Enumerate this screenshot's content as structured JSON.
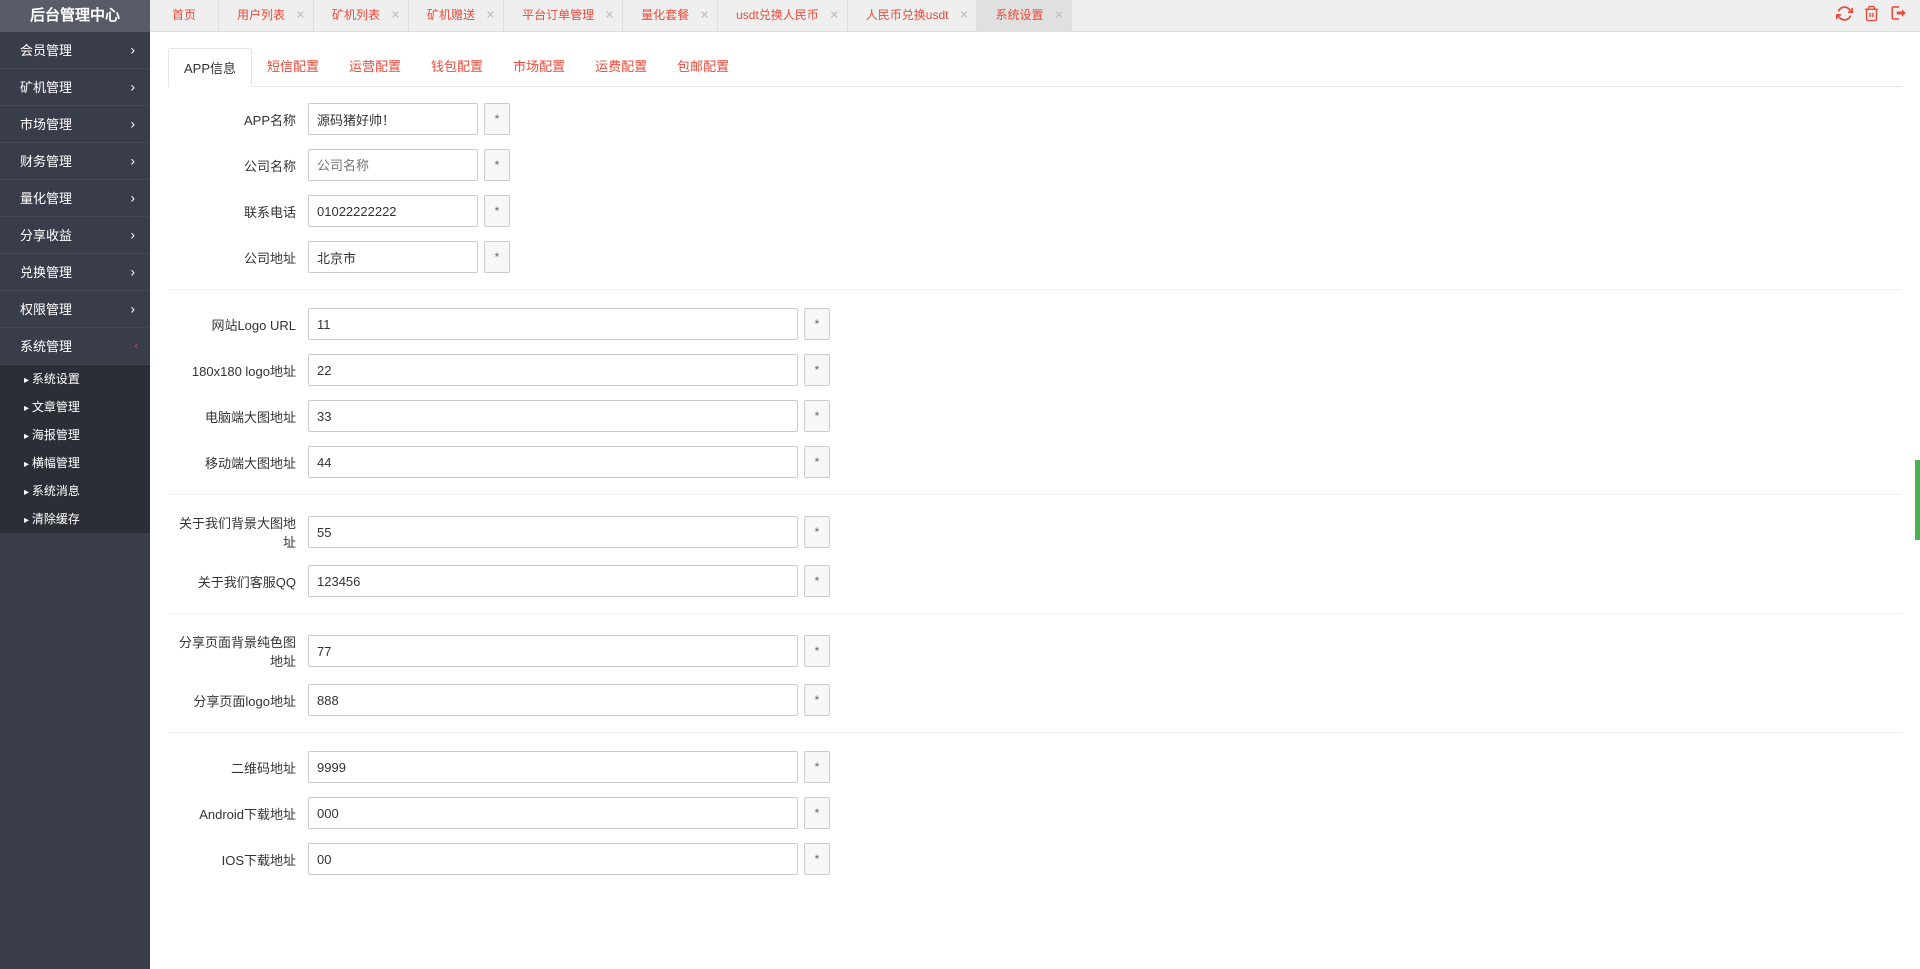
{
  "app_title": "后台管理中心",
  "sidebar": {
    "items": [
      {
        "label": "会员管理",
        "expandable": true
      },
      {
        "label": "矿机管理",
        "expandable": true
      },
      {
        "label": "市场管理",
        "expandable": true
      },
      {
        "label": "财务管理",
        "expandable": true
      },
      {
        "label": "量化管理",
        "expandable": true
      },
      {
        "label": "分享收益",
        "expandable": true
      },
      {
        "label": "兑换管理",
        "expandable": true
      },
      {
        "label": "权限管理",
        "expandable": true
      },
      {
        "label": "系统管理",
        "expandable": false,
        "expanded": true
      }
    ],
    "submenu": [
      {
        "label": "系统设置"
      },
      {
        "label": "文章管理"
      },
      {
        "label": "海报管理"
      },
      {
        "label": "横幅管理"
      },
      {
        "label": "系统消息"
      },
      {
        "label": "清除缓存"
      }
    ]
  },
  "tabs": [
    {
      "label": "首页",
      "closable": false
    },
    {
      "label": "用户列表",
      "closable": true
    },
    {
      "label": "矿机列表",
      "closable": true
    },
    {
      "label": "矿机赠送",
      "closable": true
    },
    {
      "label": "平台订单管理",
      "closable": true
    },
    {
      "label": "量化套餐",
      "closable": true
    },
    {
      "label": "usdt兑换人民币",
      "closable": true
    },
    {
      "label": "人民币兑换usdt",
      "closable": true
    },
    {
      "label": "系统设置",
      "closable": true,
      "active": true
    }
  ],
  "top_icons": {
    "refresh": "refresh-icon",
    "trash": "trash-icon",
    "logout": "logout-icon"
  },
  "inner_tabs": [
    {
      "label": "APP信息",
      "active": true
    },
    {
      "label": "短信配置"
    },
    {
      "label": "运营配置"
    },
    {
      "label": "钱包配置"
    },
    {
      "label": "市场配置"
    },
    {
      "label": "运费配置"
    },
    {
      "label": "包邮配置"
    }
  ],
  "form": {
    "groups": [
      [
        {
          "label": "APP名称",
          "value": "源码猪好帅！",
          "size": "small",
          "placeholder": "",
          "req": true
        },
        {
          "label": "公司名称",
          "value": "",
          "placeholder": "公司名称",
          "size": "small",
          "req": true
        },
        {
          "label": "联系电话",
          "value": "01022222222",
          "size": "small",
          "req": true
        },
        {
          "label": "公司地址",
          "value": "北京市",
          "size": "small",
          "req": true
        }
      ],
      [
        {
          "label": "网站Logo URL",
          "value": "11",
          "size": "large",
          "req": true
        },
        {
          "label": "180x180 logo地址",
          "value": "22",
          "size": "large",
          "req": true
        },
        {
          "label": "电脑端大图地址",
          "value": "33",
          "size": "large",
          "req": true
        },
        {
          "label": "移动端大图地址",
          "value": "44",
          "size": "large",
          "req": true
        }
      ],
      [
        {
          "label": "关于我们背景大图地址",
          "value": "55",
          "size": "large",
          "req": true
        },
        {
          "label": "关于我们客服QQ",
          "value": "123456",
          "size": "large",
          "req": true
        }
      ],
      [
        {
          "label": "分享页面背景纯色图地址",
          "value": "77",
          "size": "large",
          "req": true
        },
        {
          "label": "分享页面logo地址",
          "value": "888",
          "size": "large",
          "req": true
        }
      ],
      [
        {
          "label": "二维码地址",
          "value": "9999",
          "size": "large",
          "req": true
        },
        {
          "label": "Android下载地址",
          "value": "000",
          "size": "large",
          "req": true
        },
        {
          "label": "IOS下载地址",
          "value": "00",
          "size": "large",
          "req": true
        }
      ]
    ]
  },
  "req_mark": "*"
}
